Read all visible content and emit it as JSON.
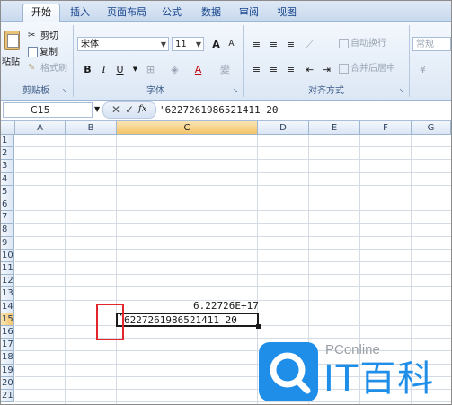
{
  "tabs": [
    "开始",
    "插入",
    "页面布局",
    "公式",
    "数据",
    "审阅",
    "视图"
  ],
  "active_tab": "开始",
  "clipboard": {
    "paste": "粘贴",
    "cut": "剪切",
    "copy": "复制",
    "format_painter": "格式刷",
    "group_label": "剪贴板"
  },
  "font": {
    "name": "宋体",
    "size": "11",
    "bold": "B",
    "italic": "I",
    "underline": "U",
    "grow": "A",
    "shrink": "A",
    "group_label": "字体"
  },
  "alignment": {
    "wrap_text": "自动换行",
    "merge_center": "合并后居中",
    "group_label": "对齐方式"
  },
  "number": {
    "format": "常规"
  },
  "formula_bar": {
    "name_box": "C15",
    "fx": "fx",
    "content": "'6227261986521411 20"
  },
  "columns": [
    "A",
    "B",
    "C",
    "D",
    "E",
    "F",
    "G"
  ],
  "selected_column": "C",
  "rows": [
    "1",
    "2",
    "3",
    "4",
    "5",
    "6",
    "7",
    "8",
    "9",
    "10",
    "11",
    "12",
    "13",
    "14",
    "15",
    "16",
    "17",
    "18",
    "19",
    "20",
    "21"
  ],
  "selected_row": "15",
  "cells": {
    "C14": "6.22726E+17",
    "C15_apostrophe": "'",
    "C15": "6227261986521411 20"
  },
  "watermark": {
    "brand": "PConline",
    "name": "IT百科"
  },
  "colors": {
    "accent_red": "#e2262b",
    "watermark_blue": "#1f8ee8",
    "selection_orange": "#f4c46a"
  }
}
